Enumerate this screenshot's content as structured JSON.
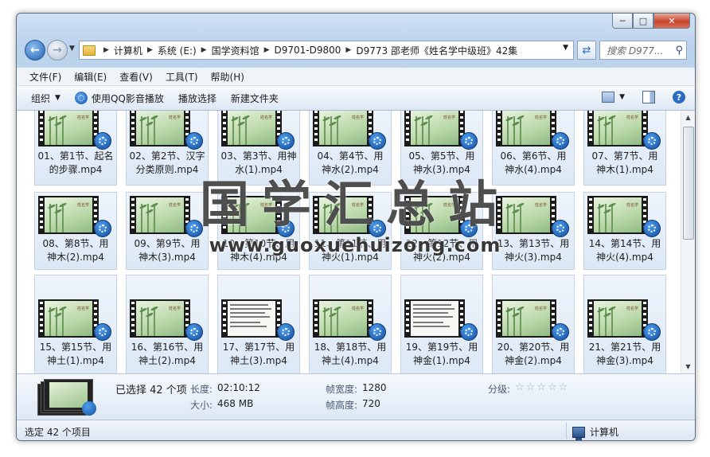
{
  "window": {
    "caption_buttons": {
      "minimize": "─",
      "maximize": "□",
      "close": "✕"
    }
  },
  "navigation": {
    "back_icon": "←",
    "forward_icon": "→",
    "breadcrumb": [
      "计算机",
      "系统 (E:)",
      "国学资料馆",
      "D9701-D9800",
      "D9773 邵老师《姓名学中级班》42集"
    ],
    "search_placeholder": "搜索 D977...",
    "refresh_icon": "refresh-icon",
    "search_icon": "search-icon"
  },
  "menu": [
    "文件(F)",
    "编辑(E)",
    "查看(V)",
    "工具(T)",
    "帮助(H)"
  ],
  "toolbar": {
    "organize": "组织",
    "play_qq": "使用QQ影音播放",
    "play_select": "播放选择",
    "new_folder": "新建文件夹",
    "help_label": "?"
  },
  "files": [
    {
      "line1": "01、第1节、起名",
      "line2": "的步骤.mp4",
      "thumb": "bamboo"
    },
    {
      "line1": "02、第2节、汉字",
      "line2": "分类原则.mp4",
      "thumb": "bamboo"
    },
    {
      "line1": "03、第3节、用神",
      "line2": "水(1).mp4",
      "thumb": "bamboo"
    },
    {
      "line1": "04、第4节、用",
      "line2": "神水(2).mp4",
      "thumb": "bamboo"
    },
    {
      "line1": "05、第5节、用",
      "line2": "神水(3).mp4",
      "thumb": "bamboo"
    },
    {
      "line1": "06、第6节、用",
      "line2": "神水(4).mp4",
      "thumb": "bamboo"
    },
    {
      "line1": "07、第7节、用",
      "line2": "神木(1).mp4",
      "thumb": "bamboo"
    },
    {
      "line1": "08、第8节、用",
      "line2": "神木(2).mp4",
      "thumb": "bamboo"
    },
    {
      "line1": "09、第9节、用",
      "line2": "神木(3).mp4",
      "thumb": "bamboo"
    },
    {
      "line1": "10、第10节、用",
      "line2": "神木(4).mp4",
      "thumb": "bamboo"
    },
    {
      "line1": "11、第11节、用",
      "line2": "神火(1).mp4",
      "thumb": "bamboo"
    },
    {
      "line1": "12、第12节、用",
      "line2": "神火(2).mp4",
      "thumb": "bamboo"
    },
    {
      "line1": "13、第13节、用",
      "line2": "神火(3).mp4",
      "thumb": "bamboo"
    },
    {
      "line1": "14、第14节、用",
      "line2": "神火(4).mp4",
      "thumb": "bamboo"
    },
    {
      "line1": "15、第15节、用",
      "line2": "神土(1).mp4",
      "thumb": "bamboo"
    },
    {
      "line1": "16、第16节、用",
      "line2": "神土(2).mp4",
      "thumb": "bamboo"
    },
    {
      "line1": "17、第17节、用",
      "line2": "神土(3).mp4",
      "thumb": "document"
    },
    {
      "line1": "18、第18节、用",
      "line2": "神土(4).mp4",
      "thumb": "bamboo"
    },
    {
      "line1": "19、第19节、用",
      "line2": "神金(1).mp4",
      "thumb": "document"
    },
    {
      "line1": "20、第20节、用",
      "line2": "神金(2).mp4",
      "thumb": "bamboo"
    },
    {
      "line1": "21、第21节、用",
      "line2": "神金(3).mp4",
      "thumb": "bamboo"
    }
  ],
  "thumbnail_title": "姓名学",
  "watermark": {
    "title": "国学汇总站",
    "url": "www.guoxuehuizong.com"
  },
  "details": {
    "selected": "已选择 42 个项",
    "length_label": "长度:",
    "length_value": "02:10:12",
    "size_label": "大小:",
    "size_value": "468 MB",
    "frame_width_label": "帧宽度:",
    "frame_width_value": "1280",
    "frame_height_label": "帧高度:",
    "frame_height_value": "720",
    "rating_label": "分级:",
    "rating_stars": "☆☆☆☆☆"
  },
  "status": {
    "left": "选定 42 个项目",
    "right": "计算机"
  },
  "colors": {
    "accent": "#1f5fb3",
    "tile_border": "#c5d3e4",
    "tile_fill": "#dce8f6",
    "bamboo_green": "#b9d8a8"
  }
}
